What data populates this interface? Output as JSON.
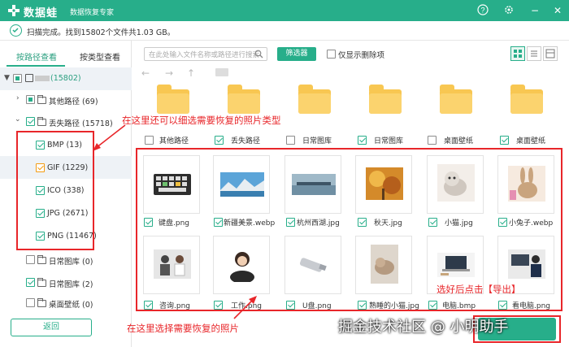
{
  "app": {
    "name": "数据蛙",
    "subtitle": "数据恢复专家"
  },
  "window": {
    "help": "?",
    "minimize": "−",
    "close": "✕"
  },
  "status": {
    "text": "扫描完成。找到15802个文件共1.03 GB。"
  },
  "left": {
    "tabs": [
      {
        "label": "按路径查看"
      },
      {
        "label": "按类型查看"
      }
    ],
    "root_count": "(15802)",
    "tree": [
      {
        "label": "其他路径 (69)"
      },
      {
        "label": "丢失路径 (15718)"
      },
      {
        "label": "BMP (13)"
      },
      {
        "label": "GIF (1229)"
      },
      {
        "label": "ICO (338)"
      },
      {
        "label": "JPG (2671)"
      },
      {
        "label": "PNG (11467)"
      },
      {
        "label": "日常图库 (0)"
      },
      {
        "label": "日常图库 (2)"
      },
      {
        "label": "桌面壁纸 (0)"
      }
    ],
    "back_label": "返回"
  },
  "toolbar": {
    "search_placeholder": "在此处输入文件名称或路径进行搜索",
    "filter_label": "筛选器",
    "deleted_only_label": "仅显示删除项"
  },
  "folders": [
    {
      "label": "其他路径"
    },
    {
      "label": "丢失路径"
    },
    {
      "label": "日常图库"
    },
    {
      "label": "日常图库"
    },
    {
      "label": "桌面壁纸"
    },
    {
      "label": "桌面壁纸"
    }
  ],
  "files_row1": [
    {
      "label": "键盘.png"
    },
    {
      "label": "新疆美景.webp"
    },
    {
      "label": "杭州西湖.jpg"
    },
    {
      "label": "秋天.jpg"
    },
    {
      "label": "小猫.jpg"
    },
    {
      "label": "小兔子.webp"
    }
  ],
  "files_row2": [
    {
      "label": "咨询.png"
    },
    {
      "label": "工作.png"
    },
    {
      "label": "U盘.png"
    },
    {
      "label": "熟睡的小猫.jpg"
    },
    {
      "label": "电脑.bmp"
    },
    {
      "label": "看电脑.png"
    }
  ],
  "annotations": {
    "filter_types": "在这里还可以细选需要恢复的照片类型",
    "select_here": "在这里选择需要恢复的照片",
    "export_hint": "选好后点击【导出】"
  },
  "watermark": "掘金技术社区 @ 小明助手",
  "colors": {
    "brand": "#27ae8a",
    "annotation": "#e8262a",
    "folder": "#f8c752"
  }
}
